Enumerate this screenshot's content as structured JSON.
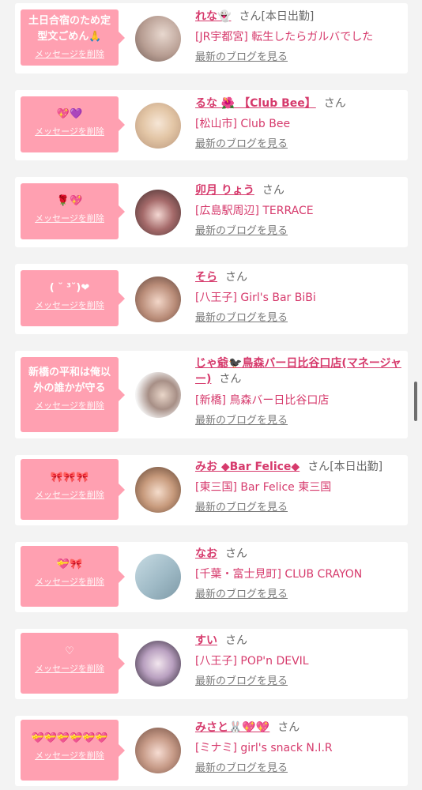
{
  "common": {
    "delete_label": "メッセージを削除",
    "blog_label": "最新のブログを見る",
    "san": "さん"
  },
  "colors": {
    "accent": "#ffa0b1",
    "name_pink": "#d63a6c",
    "background": "#f3f3f3"
  },
  "items": [
    {
      "message": "土日合宿のため定型文ごめん🙏",
      "name": "れな👻",
      "badge": "[本日出勤]",
      "shop": "[JR宇都宮] 転生したらガルバでした"
    },
    {
      "message": "💖💜",
      "name": "るな 🌺 【Club Bee】",
      "badge": "",
      "shop": "[松山市] Club Bee"
    },
    {
      "message": "🌹💖",
      "name": "卯月 りょう",
      "badge": "",
      "shop": "[広島駅周辺] TERRACE"
    },
    {
      "message": "( ˘ ³˘)❤",
      "name": "そら",
      "badge": "",
      "shop": "[八王子] Girl's Bar BiBi"
    },
    {
      "message": "新橋の平和は俺以外の誰かが守る",
      "name": "じゃ爺🐦‍⬛鳥森バー日比谷口店(マネージャー)",
      "badge": "",
      "shop": "[新橋] 鳥森バー日比谷口店"
    },
    {
      "message": "🎀🎀🎀",
      "name": "みお ◆Bar Felice◆",
      "badge": "[本日出勤]",
      "shop": "[東三国] Bar Felice 東三国"
    },
    {
      "message": "💝🎀",
      "name": "なお",
      "badge": "",
      "shop": "[千葉・富士見町] CLUB CRAYON"
    },
    {
      "message": "♡",
      "name": "すい",
      "badge": "",
      "shop": "[八王子] POP'n DEVIL"
    },
    {
      "message": "💝💝💝💝💝💝",
      "name": "みさと🐰💖💖",
      "badge": "",
      "shop": "[ミナミ] girl's snack N.I.R"
    }
  ]
}
